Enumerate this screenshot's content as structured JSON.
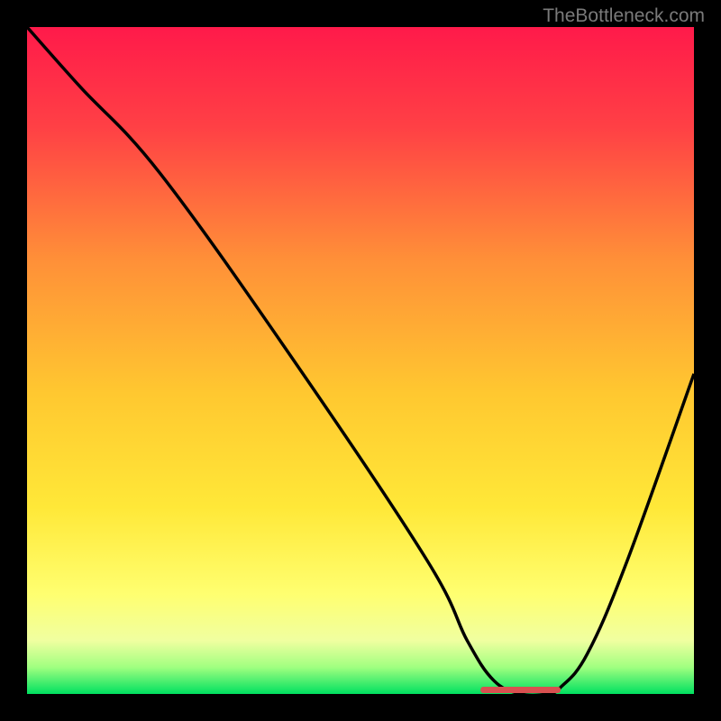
{
  "watermark": "TheBottleneck.com",
  "chart_data": {
    "type": "line",
    "title": "",
    "xlabel": "",
    "ylabel": "",
    "xlim": [
      0,
      100
    ],
    "ylim": [
      0,
      100
    ],
    "line": {
      "x": [
        0,
        8,
        20,
        40,
        60,
        66,
        70,
        74,
        78,
        80,
        84,
        90,
        100
      ],
      "y": [
        100,
        91,
        78,
        50,
        20,
        8,
        2,
        0,
        0,
        1,
        6,
        20,
        48
      ]
    },
    "optimal_range": {
      "x_start": 68,
      "x_end": 80
    },
    "gradient_colors": {
      "top": "#ff1a4a",
      "upper_mid": "#ff6040",
      "mid": "#ffb030",
      "lower_mid": "#ffe838",
      "lower": "#ffff70",
      "near_bottom": "#d0ff60",
      "bottom": "#00e060"
    }
  }
}
